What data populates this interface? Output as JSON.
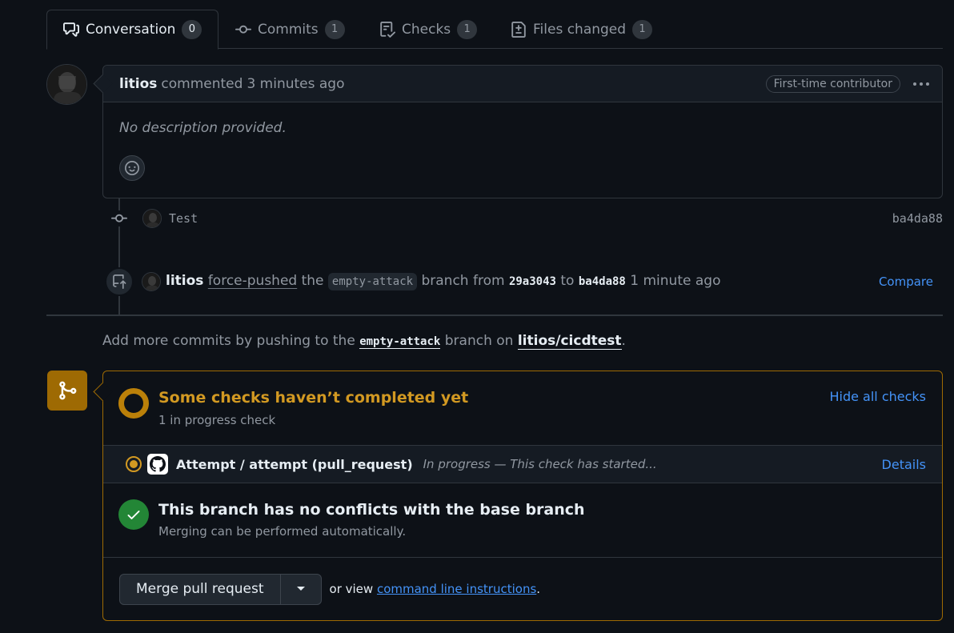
{
  "tabs": [
    {
      "label": "Conversation",
      "count": "0",
      "icon": "comment-discussion-icon"
    },
    {
      "label": "Commits",
      "count": "1",
      "icon": "git-commit-icon"
    },
    {
      "label": "Checks",
      "count": "1",
      "icon": "checklist-icon"
    },
    {
      "label": "Files changed",
      "count": "1",
      "icon": "file-diff-icon"
    }
  ],
  "comment": {
    "author": "litios",
    "action": "commented",
    "time": "3 minutes ago",
    "badge": "First-time contributor",
    "body": "No description provided."
  },
  "commit": {
    "message": "Test",
    "sha": "ba4da88"
  },
  "force_push": {
    "author": "litios",
    "action": "force-pushed",
    "the": "the",
    "branch": "empty-attack",
    "branch_from": "branch from",
    "from_sha": "29a3043",
    "to": "to",
    "to_sha": "ba4da88",
    "time": "1 minute ago",
    "compare_label": "Compare"
  },
  "add_more": {
    "prefix": "Add more commits by pushing to the",
    "branch": "empty-attack",
    "middle": "branch on",
    "repo": "litios/cicdtest",
    "suffix": "."
  },
  "checks": {
    "title": "Some checks haven’t completed yet",
    "subtitle": "1 in progress check",
    "hide_label": "Hide all checks",
    "item_name": "Attempt / attempt (pull_request)",
    "item_status": "In progress — This check has started...",
    "details_label": "Details"
  },
  "conflicts": {
    "title": "This branch has no conflicts with the base branch",
    "subtitle": "Merging can be performed automatically."
  },
  "merge": {
    "button_label": "Merge pull request",
    "or_view": "or view",
    "cli_link": "command line instructions",
    "period": "."
  },
  "colors": {
    "accent_link": "#4493f8",
    "pending": "#d29922",
    "success": "#238636",
    "background": "#0d1117"
  }
}
